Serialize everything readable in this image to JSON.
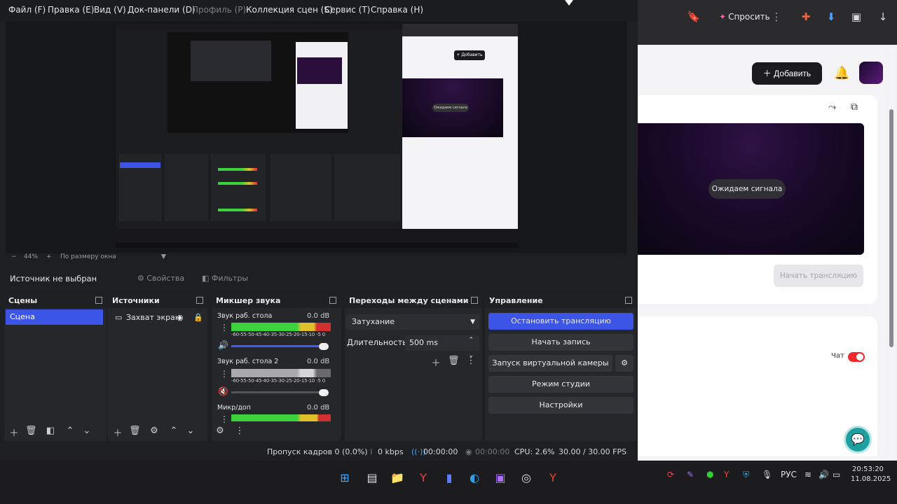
{
  "browser": {
    "ask_label": "Спросить",
    "add_label": "Добавить",
    "waiting_label": "Ожидаем сигнала",
    "start_stream_label": "Начать трансляцию",
    "chat_label": "Чат",
    "chat_enabled": true
  },
  "obs": {
    "menu": [
      "Файл (F)",
      "Правка (E)",
      "Вид (V)",
      "Док-панели (D)",
      "Профиль (P)",
      "Коллекция сцен (S)",
      "Сервис (T)",
      "Справка (H)"
    ],
    "menu_disabled_index": 4,
    "zoom": "44%",
    "zoom_mode": "По размеру окна",
    "no_source": "Источник не выбран",
    "properties_label": "Свойства",
    "filters_label": "Фильтры",
    "docks": {
      "scenes": {
        "title": "Сцены",
        "items": [
          "Сцена"
        ]
      },
      "sources": {
        "title": "Источники",
        "items": [
          "Захват экран"
        ]
      },
      "mixer": {
        "title": "Микшер звука",
        "channels": [
          {
            "name": "Звук раб. стола",
            "db": "0.0 dB",
            "scale": "-60-55-50-45-40-35-30-25-20-15-10 -5  0"
          },
          {
            "name": "Звук раб. стола 2",
            "db": "0.0 dB",
            "scale": "-60-55-50-45-40-35-30-25-20-15-10 -5  0"
          },
          {
            "name": "Микр/доп",
            "db": "0.0 dB"
          }
        ]
      },
      "transitions": {
        "title": "Переходы между сценами",
        "type": "Затухание",
        "duration_label": "Длительность",
        "duration_value": "500 ms"
      },
      "controls": {
        "title": "Управление",
        "stop_stream": "Остановить трансляцию",
        "start_record": "Начать запись",
        "virtual_cam": "Запуск виртуальной камеры",
        "studio_mode": "Режим студии",
        "settings": "Настройки"
      }
    },
    "status": {
      "dropped": "Пропуск кадров 0 (0.0%)",
      "kbps": "0 kbps",
      "stream_time": "00:00:00",
      "record_time": "00:00:00",
      "cpu": "CPU: 2.6%",
      "fps": "30.00 / 30.00 FPS"
    }
  },
  "taskbar": {
    "lang": "РУС",
    "time": "20:53:20",
    "date": "11.08.2025"
  },
  "colors": {
    "accent": "#3c55e6",
    "red": "#ef2a2a"
  }
}
